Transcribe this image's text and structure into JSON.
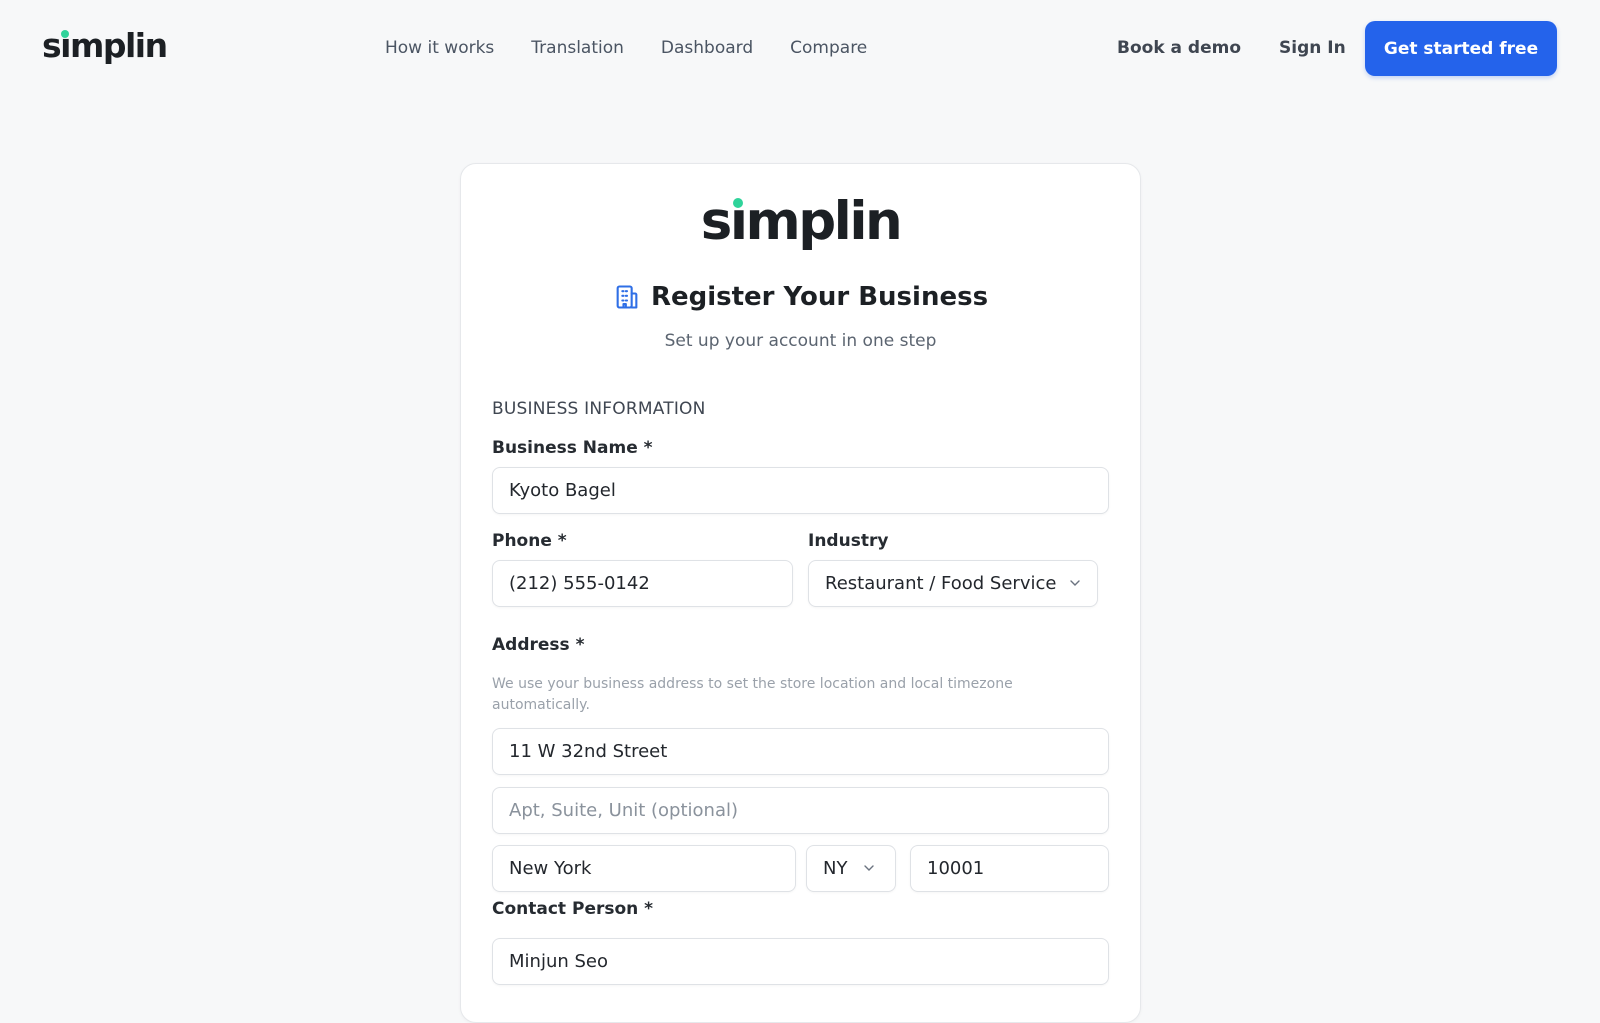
{
  "brand": {
    "name_pre": "s",
    "name_i": "ı",
    "name_post": "mplin"
  },
  "nav": {
    "items": [
      {
        "label": "How it works"
      },
      {
        "label": "Translation"
      },
      {
        "label": "Dashboard"
      },
      {
        "label": "Compare"
      }
    ],
    "book_demo": "Book a demo",
    "sign_in": "Sign In",
    "cta": "Get started free"
  },
  "form": {
    "title": "Register Your Business",
    "subtitle": "Set up your account in one step",
    "section": "BUSINESS INFORMATION",
    "business_name": {
      "label": "Business Name *",
      "value": "Kyoto Bagel"
    },
    "phone": {
      "label": "Phone *",
      "value": "(212) 555-0142"
    },
    "industry": {
      "label": "Industry",
      "value": "Restaurant / Food Service"
    },
    "address": {
      "label": "Address *",
      "hint": "We use your business address to set the store location and local timezone automatically.",
      "street": "11 W 32nd Street",
      "unit_placeholder": "Apt, Suite, Unit (optional)",
      "city": "New York",
      "state": "NY",
      "zip": "10001"
    },
    "contact": {
      "label": "Contact Person *",
      "value": "Minjun Seo"
    }
  },
  "colors": {
    "accent": "#2463eb",
    "brand_dot": "#2fd39a",
    "icon": "#2f6fe6"
  },
  "icons": {
    "title_icon": "building-icon",
    "select_icon": "chevron-down-icon"
  }
}
